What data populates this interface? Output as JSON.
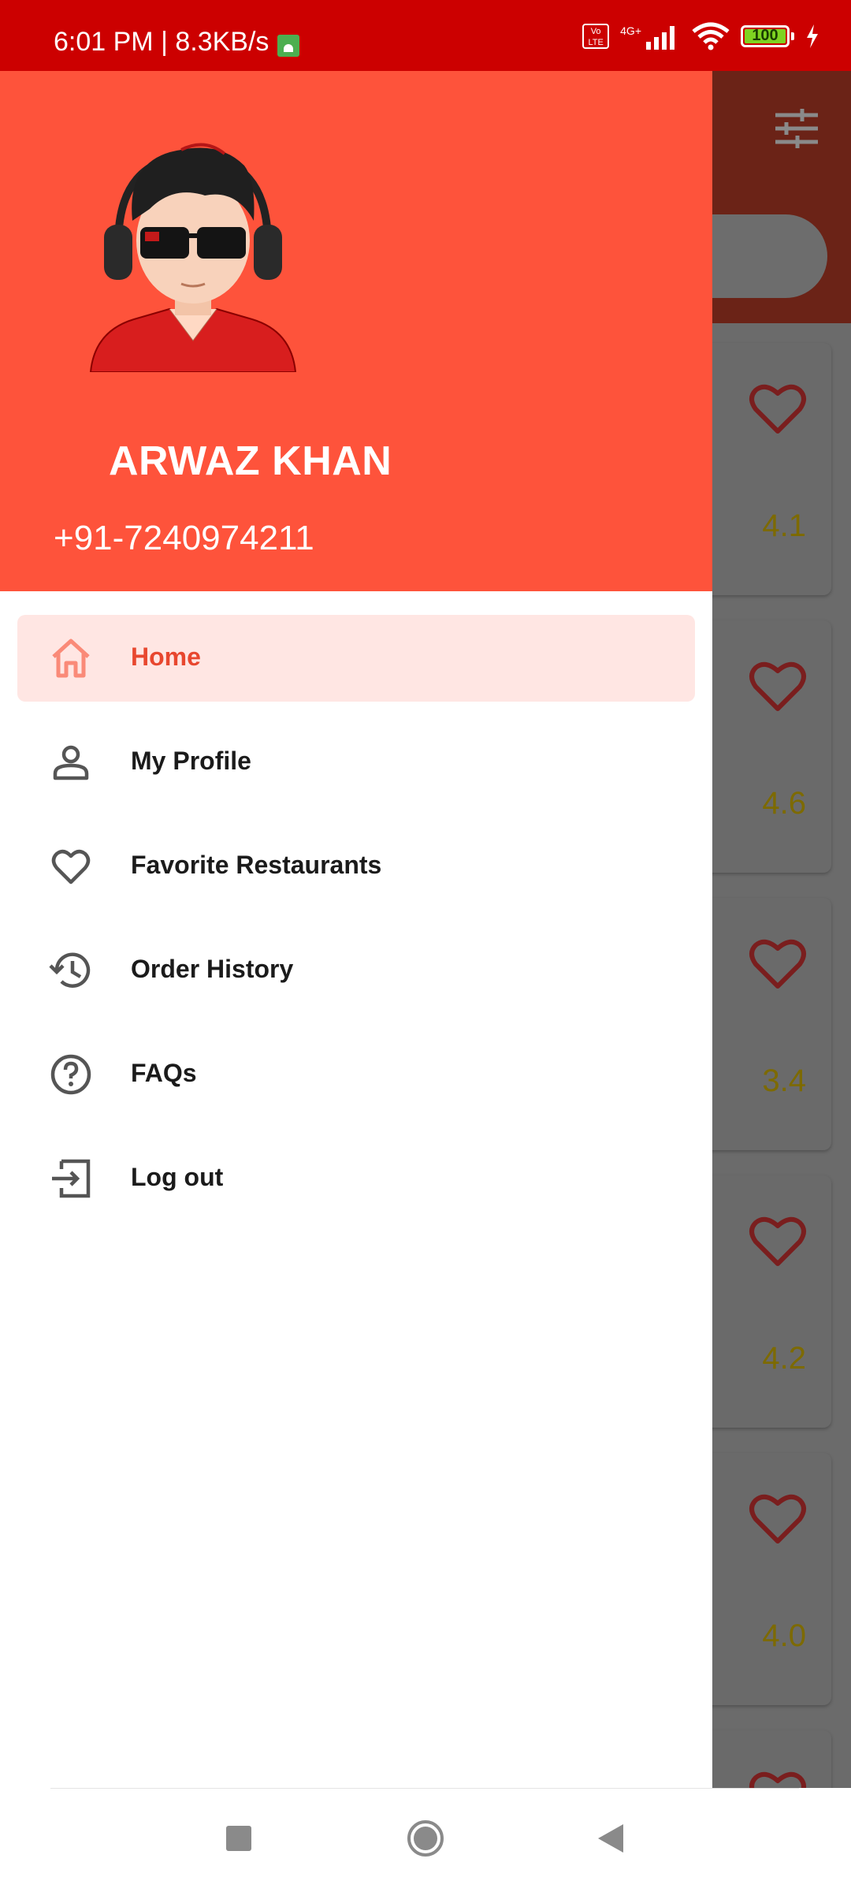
{
  "status_bar": {
    "time": "6:01 PM | 8.3KB/s",
    "network": "4G+",
    "volte": "Vo LTE",
    "battery": "100",
    "battery_level": 1.0
  },
  "background": {
    "ratings": [
      "4.1",
      "4.6",
      "3.4",
      "4.2",
      "4.0"
    ]
  },
  "drawer": {
    "user_name": "ARWAZ KHAN",
    "user_phone": "+91-7240974211",
    "menu": [
      {
        "label": "Home",
        "icon": "home-icon",
        "active": true
      },
      {
        "label": "My Profile",
        "icon": "person-icon",
        "active": false
      },
      {
        "label": "Favorite Restaurants",
        "icon": "heart-icon",
        "active": false
      },
      {
        "label": "Order History",
        "icon": "history-icon",
        "active": false
      },
      {
        "label": "FAQs",
        "icon": "help-icon",
        "active": false
      },
      {
        "label": "Log out",
        "icon": "logout-icon",
        "active": false
      }
    ]
  },
  "colors": {
    "status_bar": "#cc0000",
    "drawer_header": "#fe533b",
    "active_item_bg": "#ffe6e3",
    "active_item_text": "#e8472f"
  }
}
